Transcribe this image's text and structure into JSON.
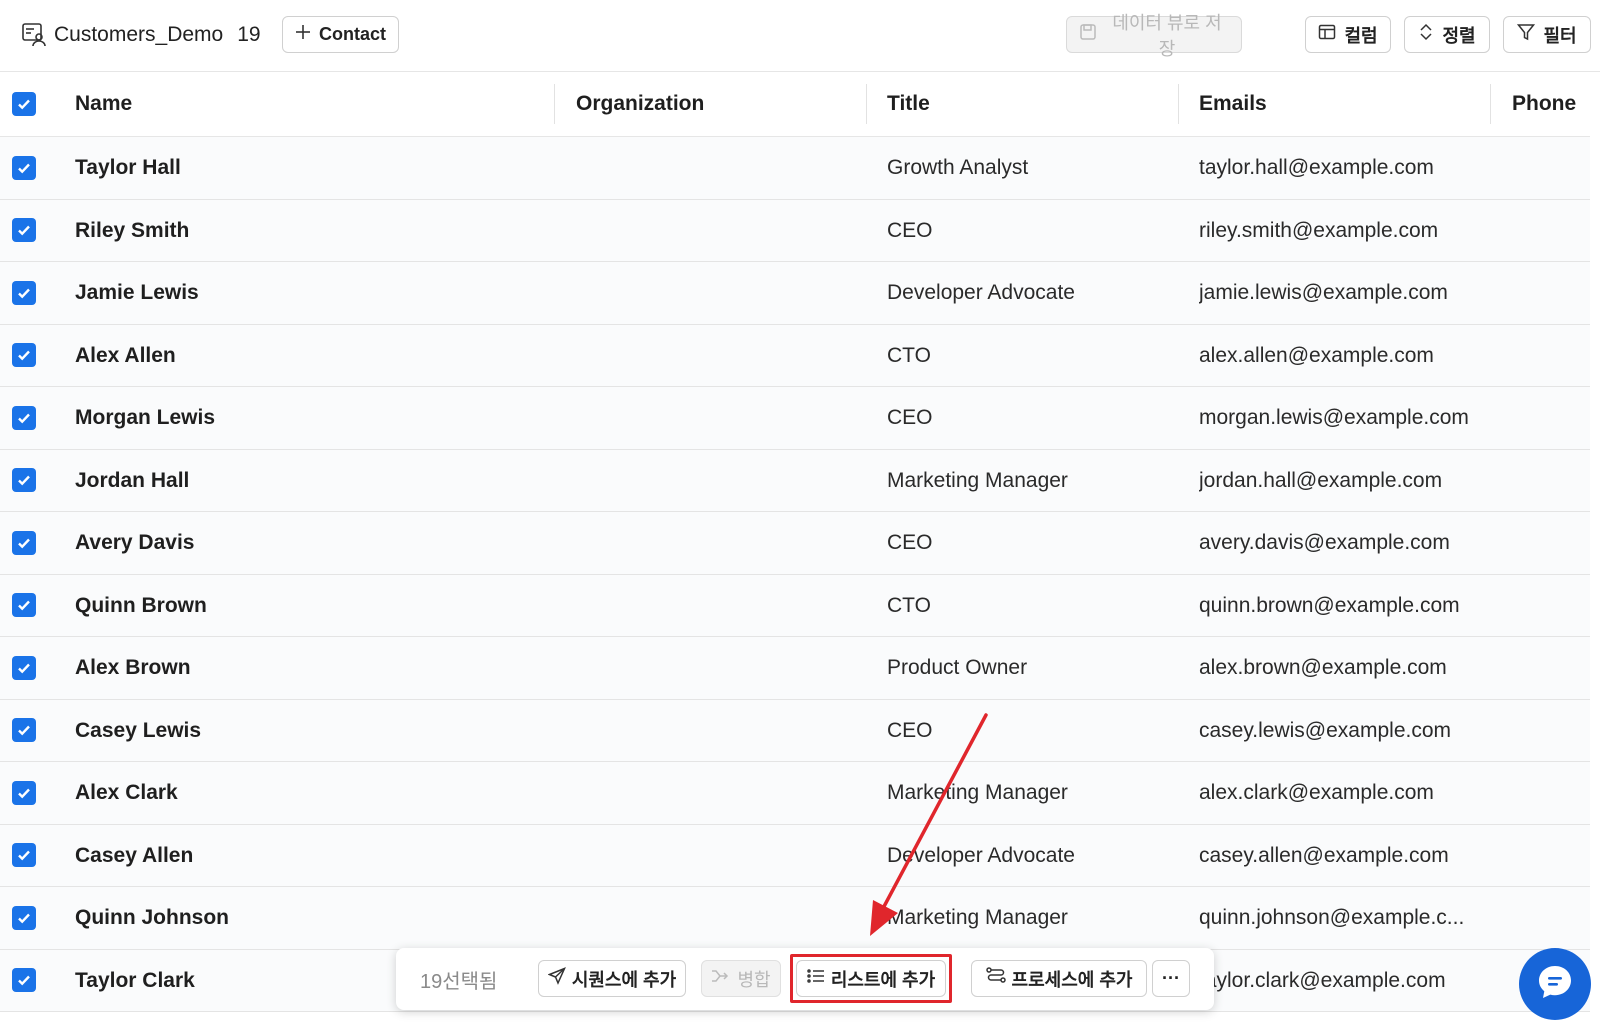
{
  "toolbar": {
    "title": "Customers_Demo",
    "count": "19",
    "contact_label": "Contact",
    "save_view_label": "데이터 뷰로 저장",
    "columns_label": "컬럼",
    "sort_label": "정렬",
    "filter_label": "필터"
  },
  "table": {
    "headers": {
      "name": "Name",
      "organization": "Organization",
      "title": "Title",
      "emails": "Emails",
      "phone": "Phone"
    },
    "rows": [
      {
        "name": "Taylor Hall",
        "title": "Growth Analyst",
        "email": "taylor.hall@example.com"
      },
      {
        "name": "Riley Smith",
        "title": "CEO",
        "email": "riley.smith@example.com"
      },
      {
        "name": "Jamie Lewis",
        "title": "Developer Advocate",
        "email": "jamie.lewis@example.com"
      },
      {
        "name": "Alex Allen",
        "title": "CTO",
        "email": "alex.allen@example.com"
      },
      {
        "name": "Morgan Lewis",
        "title": "CEO",
        "email": "morgan.lewis@example.com"
      },
      {
        "name": "Jordan Hall",
        "title": "Marketing Manager",
        "email": "jordan.hall@example.com"
      },
      {
        "name": "Avery Davis",
        "title": "CEO",
        "email": "avery.davis@example.com"
      },
      {
        "name": "Quinn Brown",
        "title": "CTO",
        "email": "quinn.brown@example.com"
      },
      {
        "name": "Alex Brown",
        "title": "Product Owner",
        "email": "alex.brown@example.com"
      },
      {
        "name": "Casey Lewis",
        "title": "CEO",
        "email": "casey.lewis@example.com"
      },
      {
        "name": "Alex Clark",
        "title": "Marketing Manager",
        "email": "alex.clark@example.com"
      },
      {
        "name": "Casey Allen",
        "title": "Developer Advocate",
        "email": "casey.allen@example.com"
      },
      {
        "name": "Quinn Johnson",
        "title": "Marketing Manager",
        "email": "quinn.johnson@example.c..."
      },
      {
        "name": "Taylor Clark",
        "title": "",
        "email": "taylor.clark@example.com"
      }
    ]
  },
  "action_bar": {
    "selected_label": "19선택됨",
    "sequence_label": "시퀀스에 추가",
    "merge_label": "병합",
    "list_label": "리스트에 추가",
    "process_label": "프로세스에 추가",
    "more_label": "···"
  },
  "colors": {
    "accent": "#1a73e8",
    "chat": "#1765d8",
    "highlight": "#e0262c"
  }
}
